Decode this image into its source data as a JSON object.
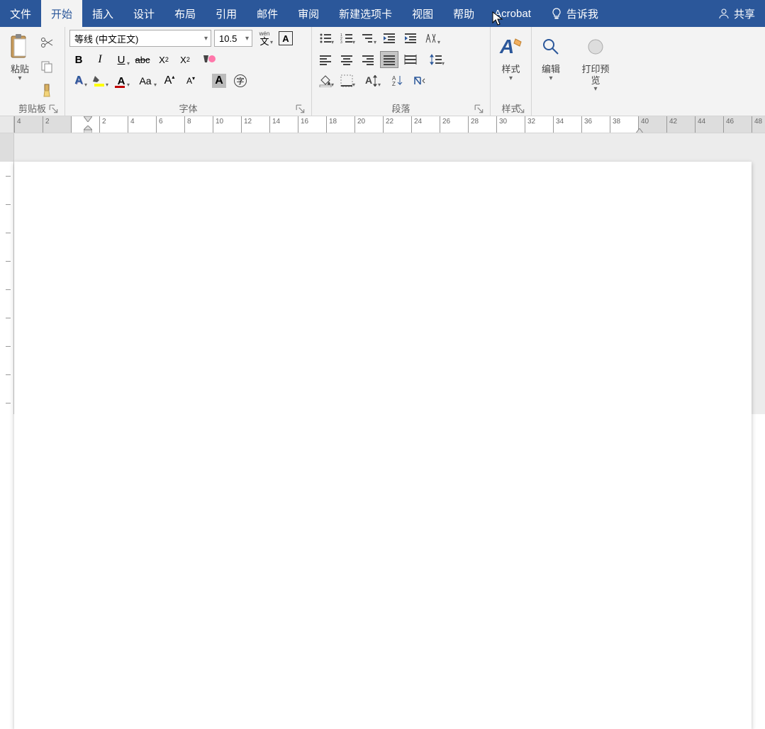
{
  "tabs": {
    "file": "文件",
    "home": "开始",
    "insert": "插入",
    "design": "设计",
    "layout": "布局",
    "references": "引用",
    "mailings": "邮件",
    "review": "审阅",
    "newtab": "新建选项卡",
    "view": "视图",
    "help": "帮助",
    "acrobat": "Acrobat",
    "tellme": "告诉我",
    "share": "共享"
  },
  "clipboard": {
    "paste": "粘贴",
    "group": "剪贴板"
  },
  "font": {
    "name": "等线 (中文正文)",
    "size": "10.5",
    "group": "字体",
    "wen": "wén",
    "wenchar": "文",
    "A": "A",
    "B": "B",
    "I": "I",
    "U": "U",
    "abc": "abc",
    "x2sub": "X",
    "x2sup": "X",
    "sub2": "2",
    "sup2": "2",
    "Aa": "Aa",
    "circleAtext": "字"
  },
  "paragraph": {
    "group": "段落"
  },
  "styles": {
    "label": "样式",
    "group": "样式"
  },
  "editing": {
    "label": "编辑"
  },
  "preview": {
    "label": "打印预览"
  },
  "ruler": {
    "marks": [
      4,
      2,
      "",
      2,
      4,
      6,
      8,
      10,
      12,
      14,
      16,
      18,
      20,
      22,
      24,
      26,
      28,
      30,
      32,
      34,
      36,
      38,
      40,
      42,
      44,
      46,
      48
    ]
  }
}
